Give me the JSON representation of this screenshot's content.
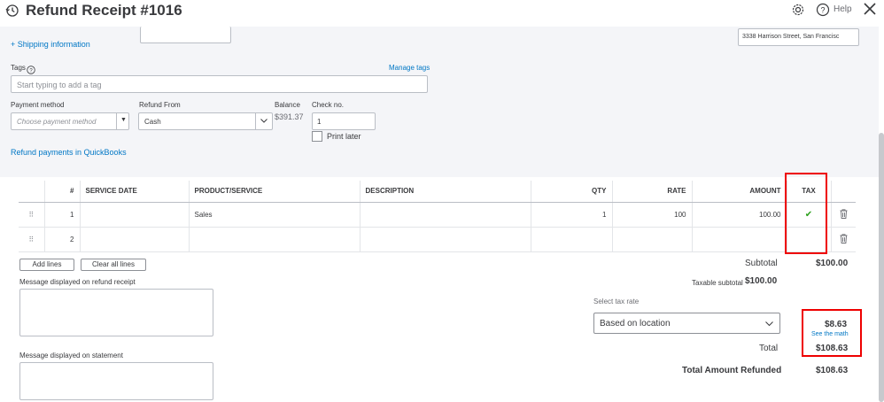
{
  "header": {
    "title": "Refund Receipt #1016",
    "help_label": "Help",
    "history_icon": "history-icon",
    "gear_icon": "gear-icon",
    "help_icon": "help-circle-icon",
    "close_icon": "close-icon"
  },
  "top": {
    "shipping_link": "+ Shipping information",
    "address_value": "3338 Harrison Street, San Francisc",
    "tags_label": "Tags",
    "manage_tags": "Manage tags",
    "tags_placeholder": "Start typing to add a tag",
    "payment_method_label": "Payment method",
    "payment_method_placeholder": "Choose payment method",
    "refund_from_label": "Refund From",
    "refund_from_value": "Cash",
    "balance_label": "Balance",
    "balance_value": "$391.37",
    "check_no_label": "Check no.",
    "check_no_value": "1",
    "print_later_label": "Print later",
    "refund_payments_link": "Refund payments in QuickBooks"
  },
  "table": {
    "headers": [
      "#",
      "SERVICE DATE",
      "PRODUCT/SERVICE",
      "DESCRIPTION",
      "QTY",
      "RATE",
      "AMOUNT",
      "TAX"
    ],
    "rows": [
      {
        "num": "1",
        "date": "",
        "product": "Sales",
        "desc": "",
        "qty": "1",
        "rate": "100",
        "amount": "100.00",
        "tax": "✔"
      },
      {
        "num": "2",
        "date": "",
        "product": "",
        "desc": "",
        "qty": "",
        "rate": "",
        "amount": "",
        "tax": ""
      }
    ]
  },
  "actions": {
    "add_lines": "Add lines",
    "clear_all_lines": "Clear all lines"
  },
  "messages": {
    "refund_receipt_label": "Message displayed on refund receipt",
    "statement_label": "Message displayed on statement"
  },
  "totals": {
    "subtotal_label": "Subtotal",
    "subtotal_value": "$100.00",
    "taxable_label": "Taxable subtotal",
    "taxable_value": "$100.00",
    "select_tax_rate_label": "Select tax rate",
    "tax_rate_value": "Based on location",
    "tax_value": "$8.63",
    "see_math": "See the math",
    "total_label": "Total",
    "total_value": "$108.63",
    "refunded_label": "Total Amount Refunded",
    "refunded_value": "$108.63"
  },
  "colors": {
    "accent": "#0077c5",
    "highlight": "#e00000",
    "check": "#2ca01c"
  }
}
